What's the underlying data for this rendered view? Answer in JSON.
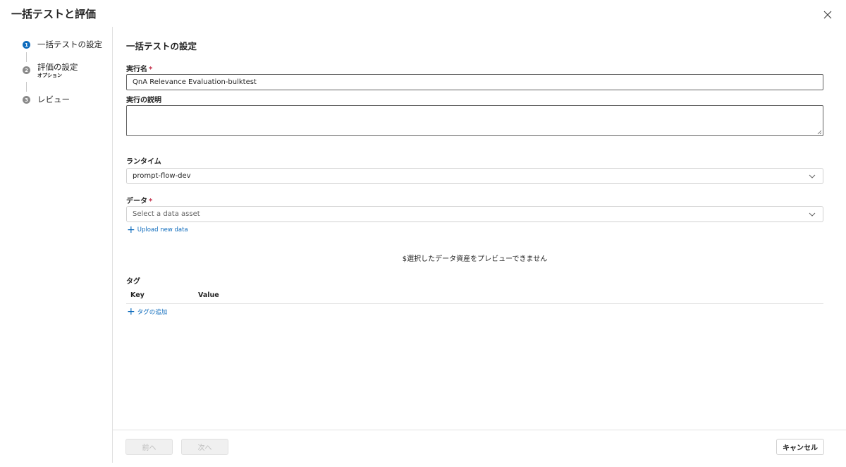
{
  "dialog": {
    "title": "一括テストと評価"
  },
  "stepper": {
    "steps": [
      {
        "number": "1",
        "label": "一括テストの設定",
        "sub": ""
      },
      {
        "number": "2",
        "label": "評価の設定",
        "sub": "オプション"
      },
      {
        "number": "3",
        "label": "レビュー",
        "sub": ""
      }
    ]
  },
  "form": {
    "section_title": "一括テストの設定",
    "run_name": {
      "label": "実行名",
      "required_mark": "*",
      "value": "QnA Relevance Evaluation-bulktest"
    },
    "run_description": {
      "label": "実行の説明",
      "value": ""
    },
    "runtime": {
      "label": "ランタイム",
      "value": "prompt-flow-dev"
    },
    "data": {
      "label": "データ",
      "required_mark": "*",
      "placeholder": "Select a data asset",
      "upload_link": "Upload new data"
    },
    "preview_message": "$選択したデータ資産をプレビューできません",
    "tags": {
      "label": "タグ",
      "columns": [
        "Key",
        "Value"
      ],
      "add_link": "タグの追加"
    }
  },
  "footer": {
    "prev_label": "前へ",
    "next_label": "次へ",
    "cancel_label": "キャンセル"
  },
  "colors": {
    "accent": "#0f6cbd",
    "required": "#c4314b"
  }
}
